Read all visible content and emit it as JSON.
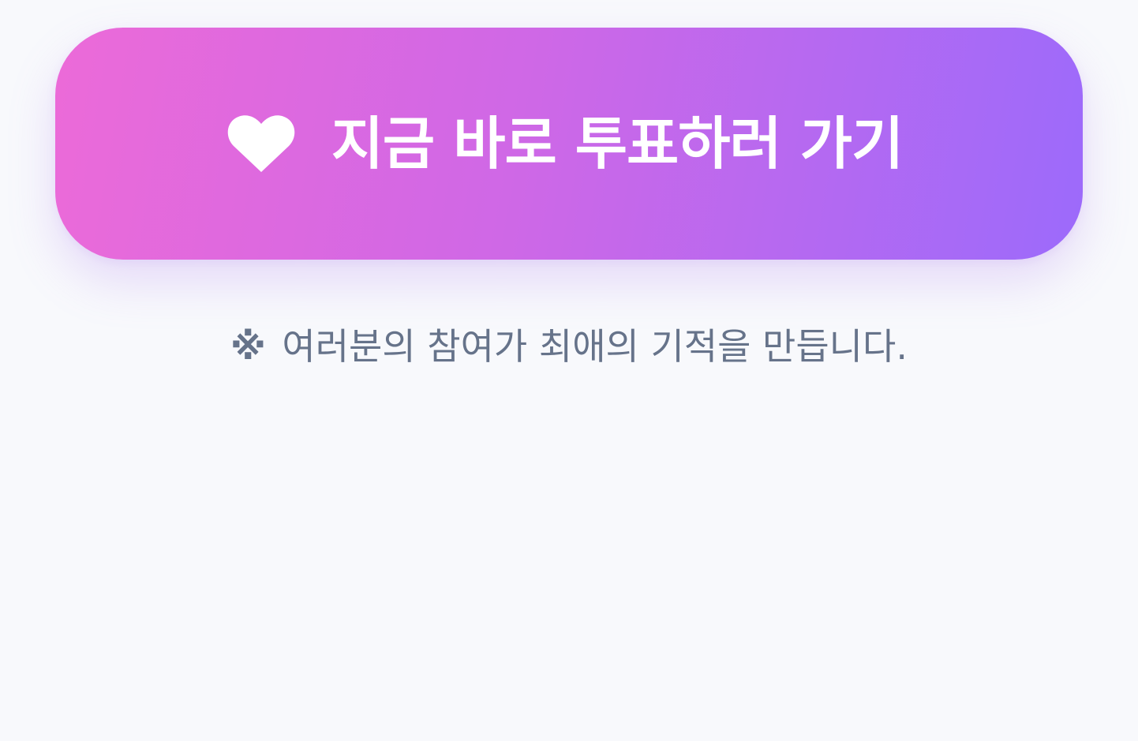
{
  "vote_button": {
    "icon": "heart-icon",
    "label": "지금 바로 투표하러 가기",
    "gradient_start": "#ec6ad8",
    "gradient_end": "#9c6afb",
    "text_color": "#ffffff"
  },
  "notice": {
    "mark": "※",
    "text": "여러분의 참여가 최애의 기적을 만듭니다.",
    "color": "#66738a"
  },
  "background_color": "#f8f9fc"
}
